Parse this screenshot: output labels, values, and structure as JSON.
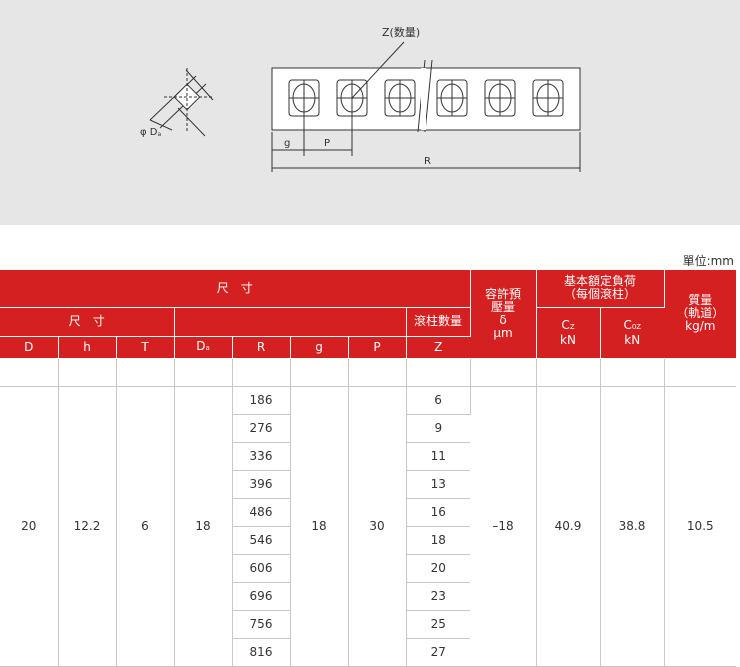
{
  "diagram": {
    "z_label": "Z(数量)",
    "phi_label": "φ D",
    "phi_sub": "a",
    "g_label": "g",
    "p_label": "P",
    "r_label": "R"
  },
  "unit": "單位:mm",
  "header": {
    "dimension_group": "尺　寸",
    "dim_subgroup": "尺　寸",
    "roller_count": "滾柱數量",
    "preload": "容許預壓量",
    "preload_symbol": "δ",
    "preload_unit": "μm",
    "load_rating": "基本額定負荷",
    "load_rating_sub": "（每個滾柱）",
    "mass": "質量",
    "mass_sub": "（軌道）",
    "mass_unit": "kg/m",
    "cz": "C",
    "cz_sub": "Z",
    "cz_unit": "kN",
    "c0z": "C",
    "c0z_sub": "0Z",
    "c0z_unit": "kN",
    "col_D": "D",
    "col_h": "h",
    "col_T": "T",
    "col_Da": "D",
    "col_Da_sub": "a",
    "col_R": "R",
    "col_g": "g",
    "col_P": "P",
    "col_Z": "Z"
  },
  "row": {
    "D": "20",
    "h": "12.2",
    "T": "6",
    "Da": "18",
    "g": "18",
    "P": "30",
    "delta": "–18",
    "Cz": "40.9",
    "C0z": "38.8",
    "mass": "10.5"
  },
  "variants": [
    {
      "R": "186",
      "Z": "6"
    },
    {
      "R": "276",
      "Z": "9"
    },
    {
      "R": "336",
      "Z": "11"
    },
    {
      "R": "396",
      "Z": "13"
    },
    {
      "R": "486",
      "Z": "16"
    },
    {
      "R": "546",
      "Z": "18"
    },
    {
      "R": "606",
      "Z": "20"
    },
    {
      "R": "696",
      "Z": "23"
    },
    {
      "R": "756",
      "Z": "25"
    },
    {
      "R": "816",
      "Z": "27"
    }
  ]
}
